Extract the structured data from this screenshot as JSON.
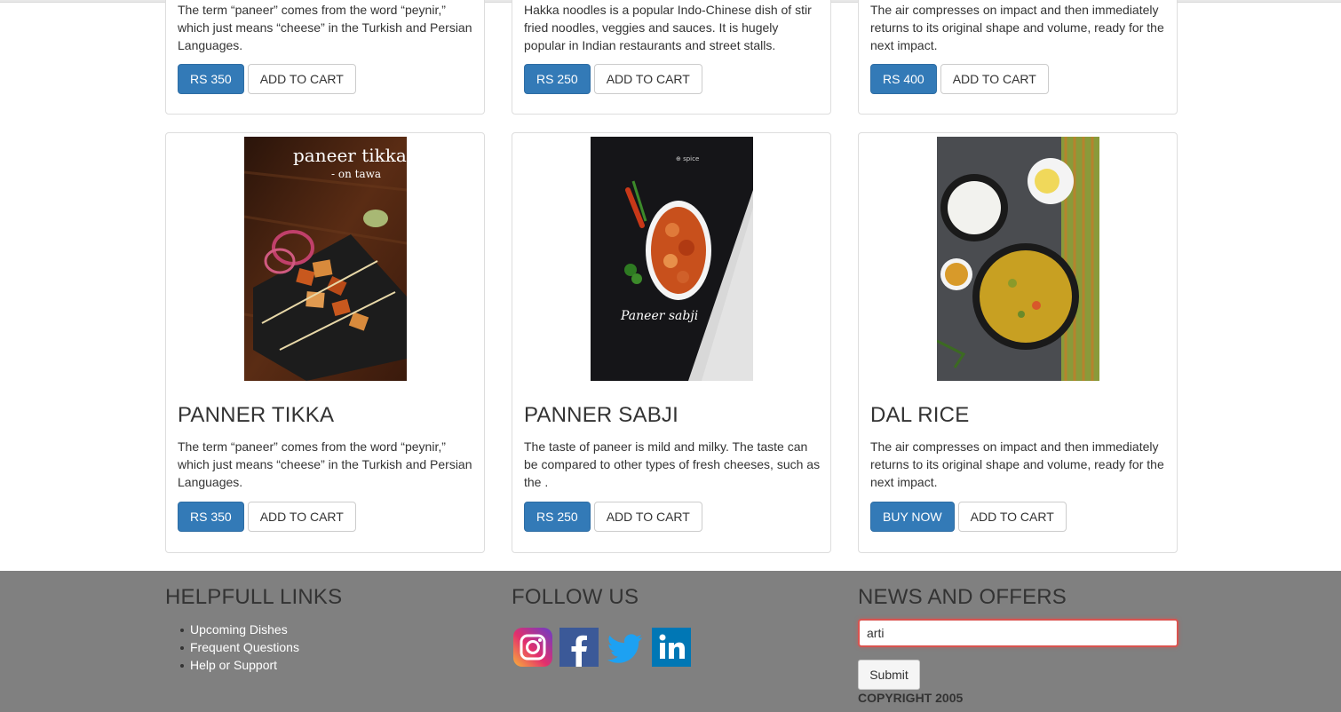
{
  "top_cards": [
    {
      "description": "The term “paneer” comes from the word “peynir,” which just means “cheese” in the Turkish and Persian Languages.",
      "price_label": "RS 350",
      "cart_label": "ADD TO CART"
    },
    {
      "description": "Hakka noodles is a popular Indo-Chinese dish of stir fried noodles, veggies and sauces. It is hugely popular in Indian restaurants and street stalls.",
      "price_label": "RS 250",
      "cart_label": "ADD TO CART"
    },
    {
      "description": "The air compresses on impact and then immediately returns to its original shape and volume, ready for the next impact.",
      "price_label": "RS 400",
      "cart_label": "ADD TO CART"
    }
  ],
  "products": [
    {
      "name": "PANNER TIKKA",
      "image_caption": "paneer tikka",
      "image_subcaption": "- on tawa",
      "description": "The term “paneer” comes from the word “peynir,” which just means “cheese” in the Turkish and Persian Languages.",
      "price_label": "RS 350",
      "cart_label": "ADD TO CART"
    },
    {
      "name": "PANNER SABJI",
      "image_caption": "Paneer sabji",
      "description": "The taste of paneer is mild and milky. The taste can be compared to other types of fresh cheeses, such as the .",
      "price_label": "RS 250",
      "cart_label": "ADD TO CART"
    },
    {
      "name": "DAL RICE",
      "description": "The air compresses on impact and then immediately returns to its original shape and volume, ready for the next impact.",
      "primary_label": "BUY NOW",
      "cart_label": "ADD TO CART"
    }
  ],
  "footer": {
    "links_title": "HELPFULL LINKS",
    "links": [
      "Upcoming Dishes",
      "Frequent Questions",
      "Help or Support"
    ],
    "follow_title": "FOLLOW US",
    "social_icons": [
      "instagram-icon",
      "facebook-icon",
      "twitter-icon",
      "linkedin-icon"
    ],
    "news_title": "NEWS AND OFFERS",
    "email_value": "arti",
    "submit_label": "Submit",
    "copyright": "COPYRIGHT 2005"
  },
  "colors": {
    "primary": "#337ab7",
    "footer_bg": "#808080",
    "input_error_border": "#d9534f",
    "instagram": "#c13584",
    "facebook": "#3b5998",
    "twitter": "#1da1f2",
    "linkedin": "#0077b5"
  }
}
